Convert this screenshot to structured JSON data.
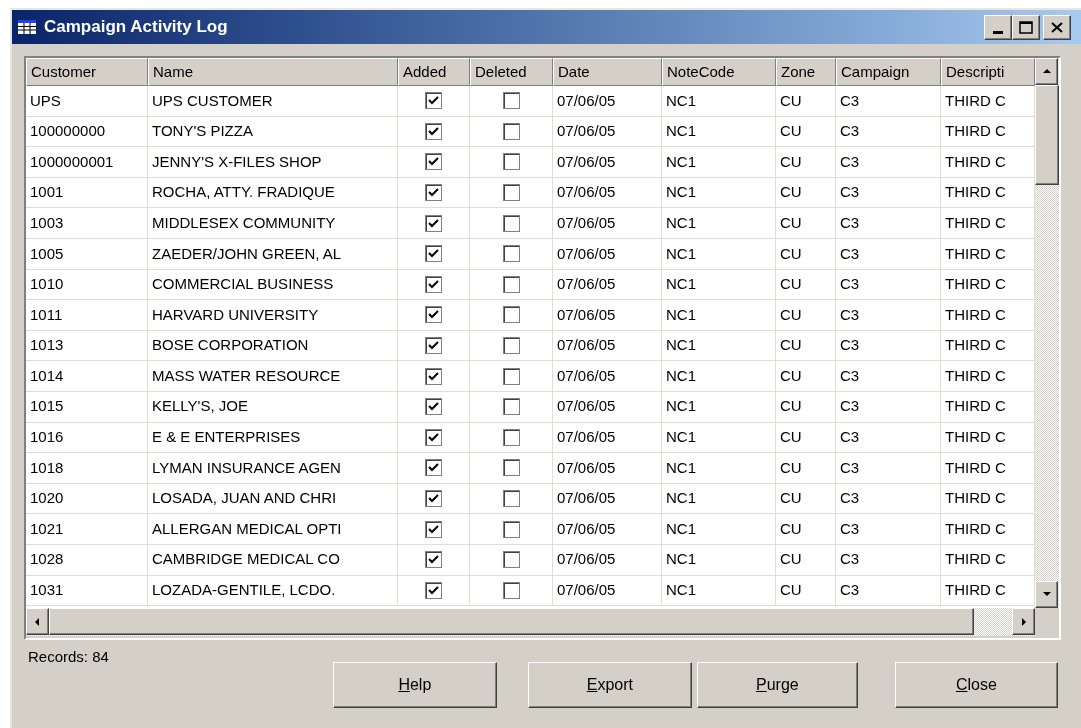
{
  "window": {
    "title": "Campaign Activity Log"
  },
  "table": {
    "columns": [
      "Customer",
      "Name",
      "Added",
      "Deleted",
      "Date",
      "NoteCode",
      "Zone",
      "Campaign",
      "Descripti"
    ],
    "rows": [
      {
        "customer": "UPS",
        "name": "UPS CUSTOMER",
        "added": true,
        "deleted": false,
        "date": "07/06/05",
        "note_code": "NC1",
        "zone": "CU",
        "campaign": "C3",
        "description": "THIRD C"
      },
      {
        "customer": "100000000",
        "name": "TONY'S PIZZA",
        "added": true,
        "deleted": false,
        "date": "07/06/05",
        "note_code": "NC1",
        "zone": "CU",
        "campaign": "C3",
        "description": "THIRD C"
      },
      {
        "customer": "1000000001",
        "name": "JENNY'S X-FILES SHOP",
        "added": true,
        "deleted": false,
        "date": "07/06/05",
        "note_code": "NC1",
        "zone": "CU",
        "campaign": "C3",
        "description": "THIRD C"
      },
      {
        "customer": "1001",
        "name": "ROCHA, ATTY. FRADIQUE",
        "added": true,
        "deleted": false,
        "date": "07/06/05",
        "note_code": "NC1",
        "zone": "CU",
        "campaign": "C3",
        "description": "THIRD C"
      },
      {
        "customer": "1003",
        "name": "MIDDLESEX COMMUNITY",
        "added": true,
        "deleted": false,
        "date": "07/06/05",
        "note_code": "NC1",
        "zone": "CU",
        "campaign": "C3",
        "description": "THIRD C"
      },
      {
        "customer": "1005",
        "name": "ZAEDER/JOHN GREEN, AL",
        "added": true,
        "deleted": false,
        "date": "07/06/05",
        "note_code": "NC1",
        "zone": "CU",
        "campaign": "C3",
        "description": "THIRD C"
      },
      {
        "customer": "1010",
        "name": "COMMERCIAL BUSINESS",
        "added": true,
        "deleted": false,
        "date": "07/06/05",
        "note_code": "NC1",
        "zone": "CU",
        "campaign": "C3",
        "description": "THIRD C"
      },
      {
        "customer": "1011",
        "name": "HARVARD UNIVERSITY",
        "added": true,
        "deleted": false,
        "date": "07/06/05",
        "note_code": "NC1",
        "zone": "CU",
        "campaign": "C3",
        "description": "THIRD C"
      },
      {
        "customer": "1013",
        "name": "BOSE CORPORATION",
        "added": true,
        "deleted": false,
        "date": "07/06/05",
        "note_code": "NC1",
        "zone": "CU",
        "campaign": "C3",
        "description": "THIRD C"
      },
      {
        "customer": "1014",
        "name": "MASS WATER RESOURCE",
        "added": true,
        "deleted": false,
        "date": "07/06/05",
        "note_code": "NC1",
        "zone": "CU",
        "campaign": "C3",
        "description": "THIRD C"
      },
      {
        "customer": "1015",
        "name": "KELLY'S, JOE",
        "added": true,
        "deleted": false,
        "date": "07/06/05",
        "note_code": "NC1",
        "zone": "CU",
        "campaign": "C3",
        "description": "THIRD C"
      },
      {
        "customer": "1016",
        "name": "E & E ENTERPRISES",
        "added": true,
        "deleted": false,
        "date": "07/06/05",
        "note_code": "NC1",
        "zone": "CU",
        "campaign": "C3",
        "description": "THIRD C"
      },
      {
        "customer": "1018",
        "name": "LYMAN INSURANCE AGEN",
        "added": true,
        "deleted": false,
        "date": "07/06/05",
        "note_code": "NC1",
        "zone": "CU",
        "campaign": "C3",
        "description": "THIRD C"
      },
      {
        "customer": "1020",
        "name": "LOSADA, JUAN AND CHRI",
        "added": true,
        "deleted": false,
        "date": "07/06/05",
        "note_code": "NC1",
        "zone": "CU",
        "campaign": "C3",
        "description": "THIRD C"
      },
      {
        "customer": "1021",
        "name": "ALLERGAN MEDICAL OPTI",
        "added": true,
        "deleted": false,
        "date": "07/06/05",
        "note_code": "NC1",
        "zone": "CU",
        "campaign": "C3",
        "description": "THIRD C"
      },
      {
        "customer": "1028",
        "name": "CAMBRIDGE MEDICAL CO",
        "added": true,
        "deleted": false,
        "date": "07/06/05",
        "note_code": "NC1",
        "zone": "CU",
        "campaign": "C3",
        "description": "THIRD C"
      },
      {
        "customer": "1031",
        "name": "LOZADA-GENTILE, LCDO.",
        "added": true,
        "deleted": false,
        "date": "07/06/05",
        "note_code": "NC1",
        "zone": "CU",
        "campaign": "C3",
        "description": "THIRD C"
      }
    ]
  },
  "status": {
    "records": "Records: 84"
  },
  "buttons": [
    {
      "label": "Help",
      "underline_first": true
    },
    {
      "label": "Export",
      "underline_first": true
    },
    {
      "label": "Purge",
      "underline_first": true
    },
    {
      "label": "Close",
      "underline_first": true
    }
  ]
}
